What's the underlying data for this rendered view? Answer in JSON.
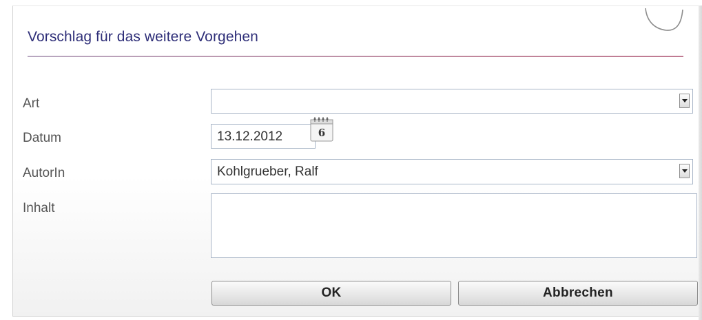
{
  "dialog": {
    "title": "Vorschlag für das weitere Vorgehen"
  },
  "form": {
    "art": {
      "label": "Art",
      "value": ""
    },
    "datum": {
      "label": "Datum",
      "value": "13.12.2012",
      "calendar_day": "6"
    },
    "autorin": {
      "label": "AutorIn",
      "value": "Kohlgrueber, Ralf"
    },
    "inhalt": {
      "label": "Inhalt",
      "value": ""
    }
  },
  "buttons": {
    "ok": "OK",
    "cancel": "Abbrechen"
  },
  "icons": {
    "select_arrow": "chevron-down-icon",
    "calendar": "calendar-icon"
  }
}
